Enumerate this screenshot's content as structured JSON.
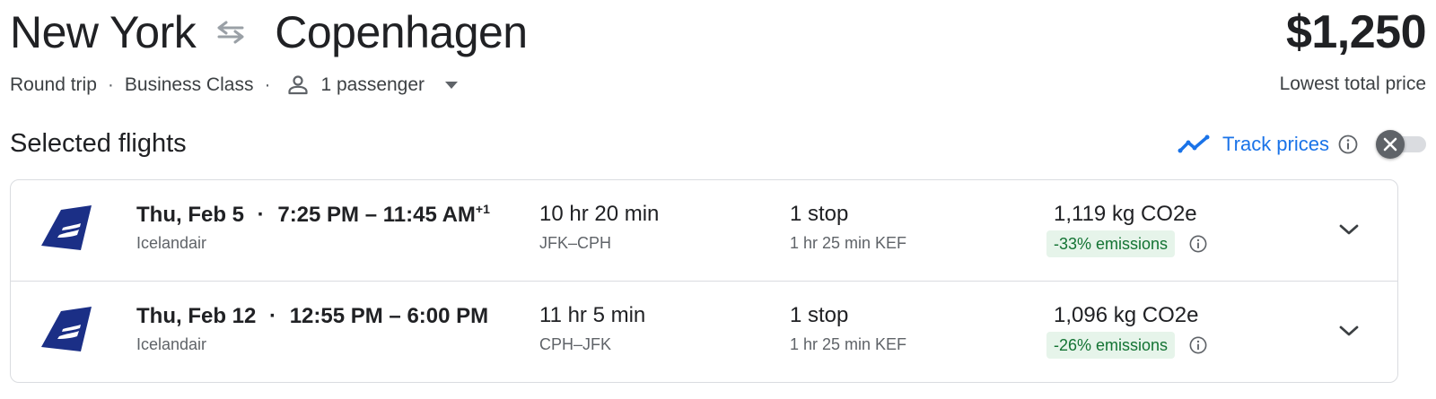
{
  "header": {
    "origin": "New York",
    "destination": "Copenhagen",
    "price": "$1,250",
    "price_label": "Lowest total price",
    "trip_type": "Round trip",
    "cabin": "Business Class",
    "passengers": "1 passenger",
    "separator": "·"
  },
  "section": {
    "title": "Selected flights",
    "track_label": "Track prices",
    "track_enabled": false
  },
  "flights": [
    {
      "date": "Thu, Feb 5",
      "times": "7:25 PM – 11:45 AM",
      "day_offset": "+1",
      "airline": "Icelandair",
      "duration": "10 hr 20 min",
      "airports": "JFK–CPH",
      "stops": "1 stop",
      "layover": "1 hr 25 min KEF",
      "co2": "1,119 kg CO2e",
      "emissions": "-33% emissions"
    },
    {
      "date": "Thu, Feb 12",
      "times": "12:55 PM – 6:00 PM",
      "day_offset": "",
      "airline": "Icelandair",
      "duration": "11 hr 5 min",
      "airports": "CPH–JFK",
      "stops": "1 stop",
      "layover": "1 hr 25 min KEF",
      "co2": "1,096 kg CO2e",
      "emissions": "-26% emissions"
    }
  ],
  "icons": {
    "swap": "swap-arrows-icon",
    "person": "person-icon",
    "dropdown": "caret-down-icon",
    "trend": "trending-line-icon",
    "info": "info-icon",
    "toggle_off": "close-icon",
    "airline_logo": "icelandair-logo",
    "expand": "chevron-down-icon"
  },
  "colors": {
    "accent": "#1a73e8",
    "emissions_bg": "#e6f4ea",
    "emissions_text": "#137333",
    "logo": "#1b2f86"
  }
}
